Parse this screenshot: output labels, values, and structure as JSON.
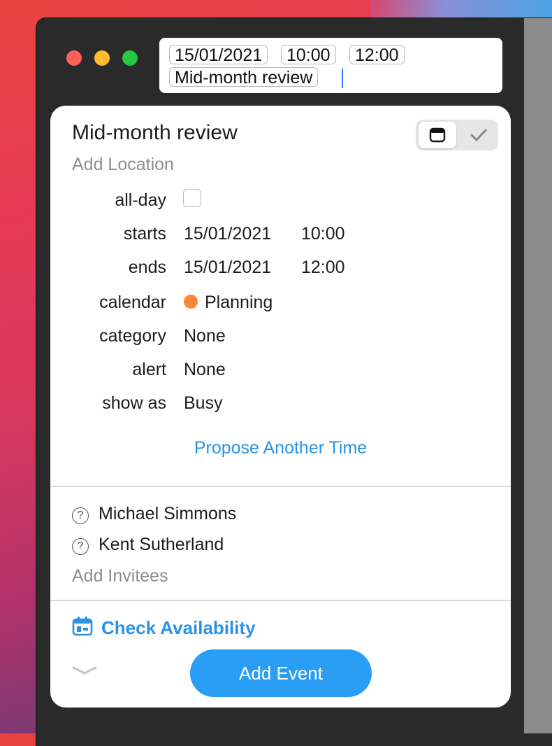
{
  "quick_entry": {
    "tokens": [
      "15/01/2021",
      "10:00",
      "12:00",
      "Mid-month review"
    ]
  },
  "event": {
    "title": "Mid-month review",
    "location_placeholder": "Add Location"
  },
  "fields": {
    "allday_label": "all-day",
    "allday_checked": false,
    "starts_label": "starts",
    "starts_date": "15/01/2021",
    "starts_time": "10:00",
    "ends_label": "ends",
    "ends_date": "15/01/2021",
    "ends_time": "12:00",
    "calendar_label": "calendar",
    "calendar_value": "Planning",
    "calendar_color": "#f5883a",
    "category_label": "category",
    "category_value": "None",
    "alert_label": "alert",
    "alert_value": "None",
    "showas_label": "show as",
    "showas_value": "Busy"
  },
  "propose_label": "Propose Another Time",
  "invitees": [
    {
      "name": "Michael Simmons",
      "status_icon": "question-circle-icon"
    },
    {
      "name": "Kent Sutherland",
      "status_icon": "question-circle-icon"
    }
  ],
  "add_invitees_label": "Add Invitees",
  "check_availability_label": "Check Availability",
  "add_event_label": "Add Event",
  "colors": {
    "accent": "#2a9df4",
    "link": "#2a93e6",
    "close": "#fe5f57",
    "minimize": "#febc2e",
    "zoom": "#28c840"
  }
}
